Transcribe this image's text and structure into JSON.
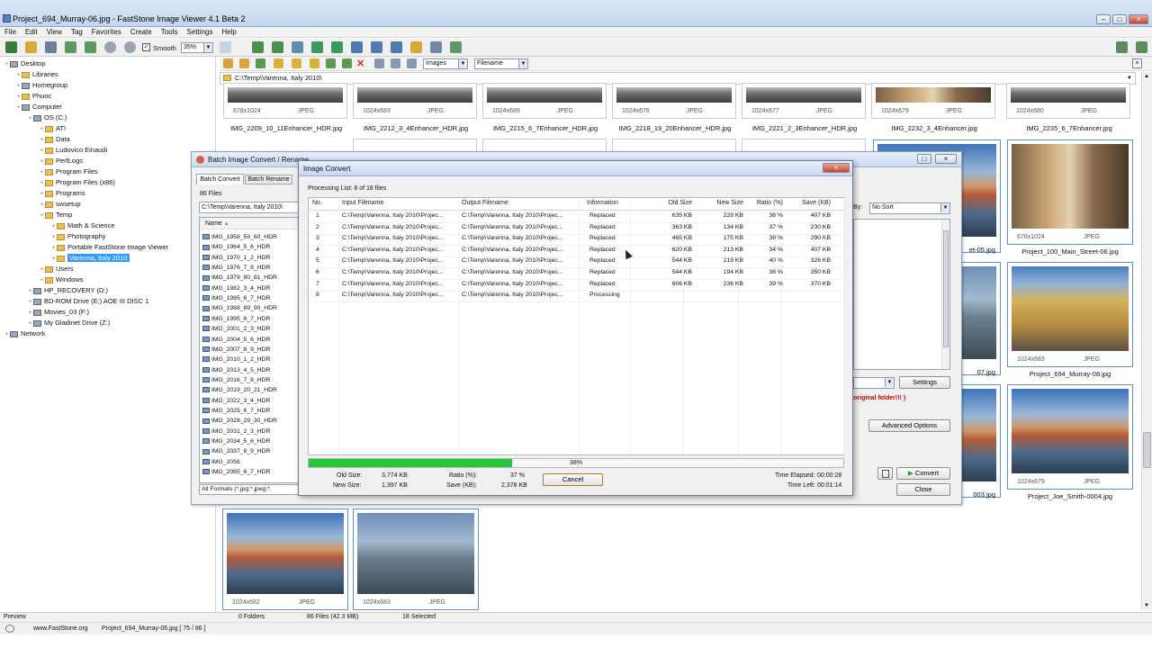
{
  "window": {
    "title": "Project_694_Murray-06.jpg - FastStone Image Viewer 4.1 Beta 2",
    "min_label": "–",
    "max_label": "□",
    "close_label": "×"
  },
  "menu": [
    "File",
    "Edit",
    "View",
    "Tag",
    "Favorites",
    "Create",
    "Tools",
    "Settings",
    "Help"
  ],
  "toolbar": {
    "smooth_label": "Smooth",
    "zoom_value": "35%",
    "filter_value": "Images",
    "sort_value": "Filename"
  },
  "path": "C:\\Temp\\Varenna, Italy 2010\\",
  "tree": [
    {
      "label": "Desktop",
      "indent": 0,
      "kind": "drive"
    },
    {
      "label": "Libraries",
      "indent": 1,
      "kind": "folder"
    },
    {
      "label": "Homegroup",
      "indent": 1,
      "kind": "drive"
    },
    {
      "label": "Phuoc",
      "indent": 1,
      "kind": "folder"
    },
    {
      "label": "Computer",
      "indent": 1,
      "kind": "drive"
    },
    {
      "label": "OS (C:)",
      "indent": 2,
      "kind": "drive"
    },
    {
      "label": "ATI",
      "indent": 3,
      "kind": "folder"
    },
    {
      "label": "Data",
      "indent": 3,
      "kind": "folder"
    },
    {
      "label": "Ludovico Einaudi",
      "indent": 3,
      "kind": "folder"
    },
    {
      "label": "PerfLogs",
      "indent": 3,
      "kind": "folder"
    },
    {
      "label": "Program Files",
      "indent": 3,
      "kind": "folder"
    },
    {
      "label": "Program Files (x86)",
      "indent": 3,
      "kind": "folder"
    },
    {
      "label": "Programs",
      "indent": 3,
      "kind": "folder"
    },
    {
      "label": "swsetup",
      "indent": 3,
      "kind": "folder"
    },
    {
      "label": "Temp",
      "indent": 3,
      "kind": "folder"
    },
    {
      "label": "Math & Science",
      "indent": 4,
      "kind": "folder"
    },
    {
      "label": "Photography",
      "indent": 4,
      "kind": "folder"
    },
    {
      "label": "Portable FastStone Image Viewer",
      "indent": 4,
      "kind": "folder"
    },
    {
      "label": "Varenna, Italy 2010",
      "indent": 4,
      "kind": "folder",
      "selected": true
    },
    {
      "label": "Users",
      "indent": 3,
      "kind": "folder"
    },
    {
      "label": "Windows",
      "indent": 3,
      "kind": "folder"
    },
    {
      "label": "HP_RECOVERY (D:)",
      "indent": 2,
      "kind": "drive"
    },
    {
      "label": "BD-ROM Drive (E:) AOE III DISC 1",
      "indent": 2,
      "kind": "drive"
    },
    {
      "label": "Movies_03 (F:)",
      "indent": 2,
      "kind": "drive"
    },
    {
      "label": "My Gladinet Drive (Z:)",
      "indent": 2,
      "kind": "drive"
    },
    {
      "label": "Network",
      "indent": 0,
      "kind": "drive"
    }
  ],
  "thumbs_top": [
    {
      "dim": "678x1024",
      "fmt": "JPEG",
      "name": "IMG_2209_10_11Enhancer_HDR.jpg"
    },
    {
      "dim": "1024x683",
      "fmt": "JPEG",
      "name": "IMG_2212_3_4Enhancer_HDR.jpg"
    },
    {
      "dim": "1024x689",
      "fmt": "JPEG",
      "name": "IMG_2215_6_7Enhancer_HDR.jpg"
    },
    {
      "dim": "1024x676",
      "fmt": "JPEG",
      "name": "IMG_2218_19_20Enhancer_HDR.jpg"
    },
    {
      "dim": "1024x677",
      "fmt": "JPEG",
      "name": "IMG_2221_2_3Enhancer_HDR.jpg"
    },
    {
      "dim": "1024x679",
      "fmt": "JPEG",
      "name": "IMG_2232_3_4Enhancer.jpg"
    },
    {
      "dim": "1024x680",
      "fmt": "JPEG",
      "name": "IMG_2235_6_7Enhancer.jpg"
    }
  ],
  "thumbs_right": [
    {
      "dim": "678x1024",
      "fmt": "JPEG",
      "name": "Project_100_Main_Street-06.jpg"
    },
    {
      "dim": "1024x683",
      "fmt": "JPEG",
      "name": "Project_694_Murray-08.jpg"
    },
    {
      "dim": "1024x679",
      "fmt": "JPEG",
      "name": "Project_Joe_Smith-0004.jpg"
    }
  ],
  "partial_names": [
    "et-05.jpg",
    "07.jpg",
    "003.jpg"
  ],
  "thumbs_bottom": [
    {
      "dim": "1024x682",
      "fmt": "JPEG"
    },
    {
      "dim": "1024x683",
      "fmt": "JPEG"
    }
  ],
  "status": {
    "preview": "Preview",
    "folders": "0 Folders",
    "files": "86 Files (42.3 MB)",
    "selected": "18 Selected",
    "website": "www.FastStone.org",
    "current": "Project_694_Murray-06.jpg [ 75 / 86 ]"
  },
  "batch": {
    "title": "Batch Image Convert / Rename",
    "tab_convert": "Batch Convert",
    "tab_rename": "Batch Rename",
    "file_count": "86 Files",
    "folder": "C:\\Temp\\Varenna, Italy 2010\\",
    "col_name": "Name",
    "files": [
      "IMG_1958_59_60_HDR",
      "IMG_1964_5_6_HDR",
      "IMG_1970_1_2_HDR",
      "IMG_1976_7_8_HDR",
      "IMG_1979_80_81_HDR",
      "IMG_1982_3_4_HDR",
      "IMG_1985_6_7_HDR",
      "IMG_1988_89_90_HDR",
      "IMG_1995_6_7_HDR",
      "IMG_2001_2_3_HDR",
      "IMG_2004_5_6_HDR",
      "IMG_2007_8_9_HDR",
      "IMG_2010_1_2_HDR",
      "IMG_2013_4_5_HDR",
      "IMG_2016_7_8_HDR",
      "IMG_2019_20_21_HDR",
      "IMG_2022_3_4_HDR",
      "IMG_2025_6_7_HDR",
      "IMG_2028_29_30_HDR",
      "IMG_2031_2_3_HDR",
      "IMG_2034_5_6_HDR",
      "IMG_2037_8_9_HDR",
      "IMG_2056",
      "IMG_2065_6_7_HDR"
    ],
    "formats": "All Formats (*.jpg;*.jpeg;*.",
    "sort_label": "By:",
    "sort_value": "No Sort",
    "settings": "Settings",
    "warning": "n original folder!!! )",
    "advanced": "Advanced Options",
    "convert": "Convert",
    "close": "Close"
  },
  "convert": {
    "title": "Image Convert",
    "processing": "Processing List: 8 of 18 files",
    "headers": [
      "No.",
      "Input Filename",
      "Output Filename",
      "Information",
      "Old Size",
      "New Size",
      "Ratio (%)",
      "Save (KB)"
    ],
    "rows": [
      [
        "1",
        "C:\\Temp\\Varenna, Italy 2010\\Projec...",
        "C:\\Temp\\Varenna, Italy 2010\\Projec...",
        "Replaced",
        "635 KB",
        "228 KB",
        "36 %",
        "407 KB"
      ],
      [
        "2",
        "C:\\Temp\\Varenna, Italy 2010\\Projec...",
        "C:\\Temp\\Varenna, Italy 2010\\Projec...",
        "Replaced",
        "363 KB",
        "134 KB",
        "37 %",
        "230 KB"
      ],
      [
        "3",
        "C:\\Temp\\Varenna, Italy 2010\\Projec...",
        "C:\\Temp\\Varenna, Italy 2010\\Projec...",
        "Replaced",
        "465 KB",
        "175 KB",
        "38 %",
        "290 KB"
      ],
      [
        "4",
        "C:\\Temp\\Varenna, Italy 2010\\Projec...",
        "C:\\Temp\\Varenna, Italy 2010\\Projec...",
        "Replaced",
        "620 KB",
        "213 KB",
        "34 %",
        "407 KB"
      ],
      [
        "5",
        "C:\\Temp\\Varenna, Italy 2010\\Projec...",
        "C:\\Temp\\Varenna, Italy 2010\\Projec...",
        "Replaced",
        "544 KB",
        "219 KB",
        "40 %",
        "326 KB"
      ],
      [
        "6",
        "C:\\Temp\\Varenna, Italy 2010\\Projec...",
        "C:\\Temp\\Varenna, Italy 2010\\Projec...",
        "Replaced",
        "544 KB",
        "194 KB",
        "36 %",
        "350 KB"
      ],
      [
        "7",
        "C:\\Temp\\Varenna, Italy 2010\\Projec...",
        "C:\\Temp\\Varenna, Italy 2010\\Projec...",
        "Replaced",
        "606 KB",
        "236 KB",
        "39 %",
        "370 KB"
      ],
      [
        "8",
        "C:\\Temp\\Varenna, Italy 2010\\Projec...",
        "C:\\Temp\\Varenna, Italy 2010\\Projec...",
        "Processing",
        "",
        "",
        "",
        ""
      ]
    ],
    "progress": 0.38,
    "progress_label": "38%",
    "old_size_label": "Old Size:",
    "old_size": "3,774 KB",
    "new_size_label": "New Size:",
    "new_size": "1,397 KB",
    "ratio_label": "Ratio (%):",
    "ratio": "37 %",
    "save_label": "Save (KB):",
    "save": "2,378 KB",
    "cancel": "Cancel",
    "elapsed_label": "Time Elapsed:",
    "elapsed": "00:00:28",
    "left_label": "Time Left:",
    "left": "00:01:14"
  },
  "colors": {
    "progress": "#27c63a",
    "accent": "#3399ff",
    "warning": "#cc0000"
  }
}
